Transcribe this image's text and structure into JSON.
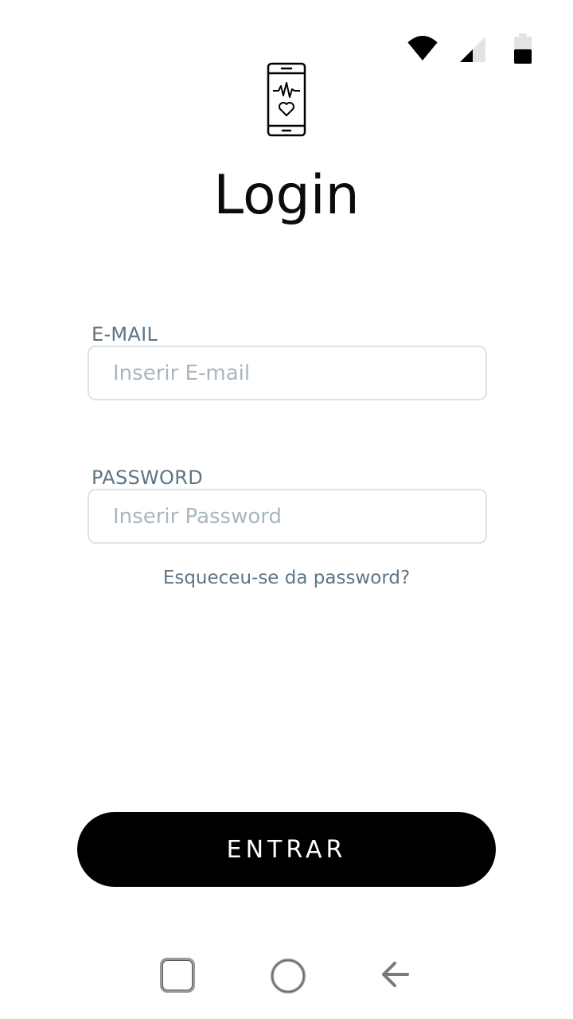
{
  "status_bar": {
    "icons": [
      "wifi-icon",
      "cellular-signal-icon",
      "battery-icon"
    ]
  },
  "logo": {
    "icon": "phone-heartbeat-icon"
  },
  "title": "Login",
  "form": {
    "email": {
      "label": "E-MAIL",
      "value": "",
      "placeholder": "Inserir E-mail"
    },
    "password": {
      "label": "PASSWORD",
      "value": "",
      "placeholder": "Inserir Password"
    },
    "forgot_password": "Esqueceu-se da password?",
    "submit_label": "ENTRAR"
  },
  "nav_bar": {
    "icons": [
      "recents-square-icon",
      "home-circle-icon",
      "back-arrow-icon"
    ]
  },
  "colors": {
    "label": "#5e7585",
    "placeholder": "#a8b6bf",
    "input_border": "#dde4e8",
    "button_bg": "#000000",
    "button_text": "#ffffff"
  }
}
